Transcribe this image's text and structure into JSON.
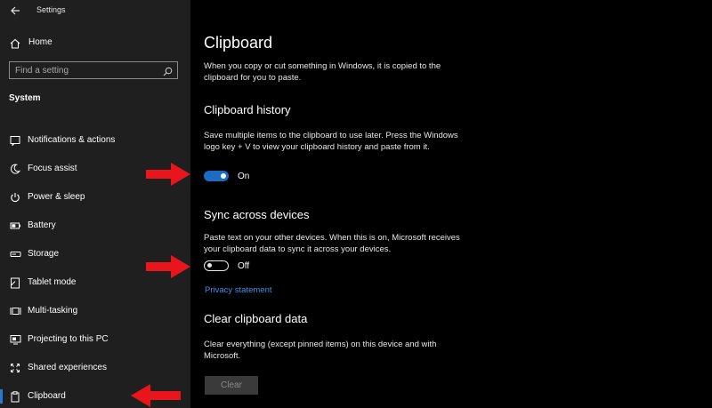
{
  "window": {
    "title": "Settings"
  },
  "sidebar": {
    "home_label": "Home",
    "search_placeholder": "Find a setting",
    "section_label": "System",
    "items": [
      {
        "label": "Notifications & actions",
        "icon": "notification-icon"
      },
      {
        "label": "Focus assist",
        "icon": "moon-icon"
      },
      {
        "label": "Power & sleep",
        "icon": "power-icon"
      },
      {
        "label": "Battery",
        "icon": "battery-icon"
      },
      {
        "label": "Storage",
        "icon": "storage-icon"
      },
      {
        "label": "Tablet mode",
        "icon": "tablet-icon"
      },
      {
        "label": "Multi-tasking",
        "icon": "multitasking-icon"
      },
      {
        "label": "Projecting to this PC",
        "icon": "projector-icon"
      },
      {
        "label": "Shared experiences",
        "icon": "shared-icon"
      },
      {
        "label": "Clipboard",
        "icon": "clipboard-icon",
        "selected": true
      }
    ]
  },
  "main": {
    "title": "Clipboard",
    "intro": "When you copy or cut something in Windows, it is copied to the clipboard for you to paste.",
    "history": {
      "heading": "Clipboard history",
      "description": "Save multiple items to the clipboard to use later. Press the Windows logo key + V to view your clipboard history and paste from it.",
      "toggle_state": "On"
    },
    "sync": {
      "heading": "Sync across devices",
      "description": "Paste text on your other devices. When this is on, Microsoft receives your clipboard data to sync it across your devices.",
      "toggle_state": "Off",
      "link": "Privacy statement"
    },
    "clear": {
      "heading": "Clear clipboard data",
      "description": "Clear everything (except pinned items) on this device and with Microsoft.",
      "button": "Clear"
    }
  },
  "colors": {
    "accent": "#1c6cc4",
    "link": "#3a8ef0",
    "annotation_arrow": "#e8161b",
    "sidebar_bg": "#1f1f1f",
    "main_bg": "#000000"
  }
}
